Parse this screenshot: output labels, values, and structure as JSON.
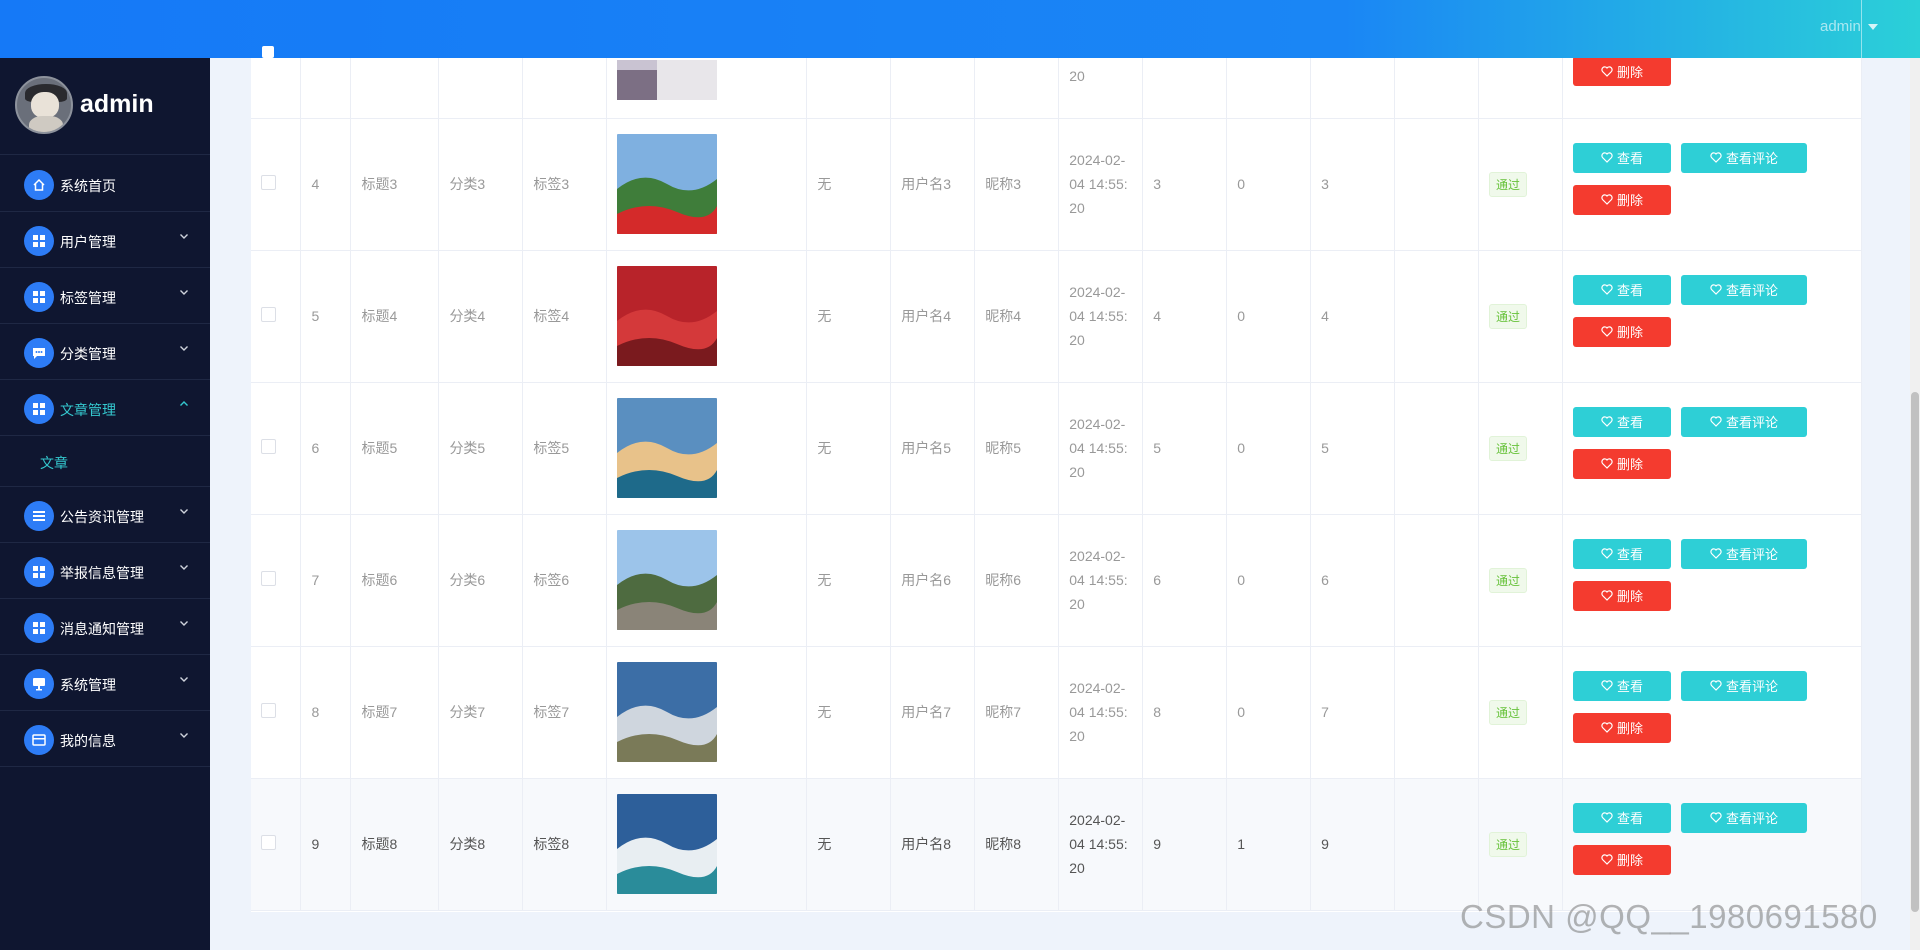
{
  "header": {
    "username": "admin"
  },
  "sidebar": {
    "brand_name": "admin",
    "items": [
      {
        "label": "系统首页",
        "icon": "home-icon"
      },
      {
        "label": "用户管理",
        "icon": "grid-icon"
      },
      {
        "label": "标签管理",
        "icon": "grid-icon"
      },
      {
        "label": "分类管理",
        "icon": "chat-icon"
      },
      {
        "label": "文章管理",
        "icon": "grid-icon",
        "active": true,
        "sub": "文章"
      },
      {
        "label": "公告资讯管理",
        "icon": "list-icon"
      },
      {
        "label": "举报信息管理",
        "icon": "grid-icon"
      },
      {
        "label": "消息通知管理",
        "icon": "grid-icon"
      },
      {
        "label": "系统管理",
        "icon": "monitor-icon"
      },
      {
        "label": "我的信息",
        "icon": "wallet-icon"
      }
    ]
  },
  "table": {
    "top_row": {
      "date_tail": "20",
      "delete_label": "删除"
    },
    "rows": [
      {
        "id": "4",
        "title": "标题3",
        "category": "分类3",
        "tag": "标签3",
        "extra": "无",
        "username": "用户名3",
        "nickname": "昵称3",
        "date1": "2024-02-",
        "date2": "04 14:55:",
        "date3": "20",
        "n1": "3",
        "n2": "0",
        "n3": "3",
        "status": "通过",
        "view": "查看",
        "comments": "查看评论",
        "delete": "删除",
        "img_colors": [
          "#7fb0e0",
          "#3f7d3a",
          "#d42a2a"
        ]
      },
      {
        "id": "5",
        "title": "标题4",
        "category": "分类4",
        "tag": "标签4",
        "extra": "无",
        "username": "用户名4",
        "nickname": "昵称4",
        "date1": "2024-02-",
        "date2": "04 14:55:",
        "date3": "20",
        "n1": "4",
        "n2": "0",
        "n3": "4",
        "status": "通过",
        "view": "查看",
        "comments": "查看评论",
        "delete": "删除",
        "img_colors": [
          "#b8232a",
          "#d4393a",
          "#7a1a1e"
        ]
      },
      {
        "id": "6",
        "title": "标题5",
        "category": "分类5",
        "tag": "标签5",
        "extra": "无",
        "username": "用户名5",
        "nickname": "昵称5",
        "date1": "2024-02-",
        "date2": "04 14:55:",
        "date3": "20",
        "n1": "5",
        "n2": "0",
        "n3": "5",
        "status": "通过",
        "view": "查看",
        "comments": "查看评论",
        "delete": "删除",
        "img_colors": [
          "#5a8fc0",
          "#e8c28a",
          "#1e6a8a"
        ]
      },
      {
        "id": "7",
        "title": "标题6",
        "category": "分类6",
        "tag": "标签6",
        "extra": "无",
        "username": "用户名6",
        "nickname": "昵称6",
        "date1": "2024-02-",
        "date2": "04 14:55:",
        "date3": "20",
        "n1": "6",
        "n2": "0",
        "n3": "6",
        "status": "通过",
        "view": "查看",
        "comments": "查看评论",
        "delete": "删除",
        "img_colors": [
          "#9cc4ea",
          "#4e6b40",
          "#8a8478"
        ]
      },
      {
        "id": "8",
        "title": "标题7",
        "category": "分类7",
        "tag": "标签7",
        "extra": "无",
        "username": "用户名7",
        "nickname": "昵称7",
        "date1": "2024-02-",
        "date2": "04 14:55:",
        "date3": "20",
        "n1": "8",
        "n2": "0",
        "n3": "7",
        "status": "通过",
        "view": "查看",
        "comments": "查看评论",
        "delete": "删除",
        "img_colors": [
          "#3c6ea6",
          "#cfd6de",
          "#7a7a58"
        ]
      },
      {
        "id": "9",
        "title": "标题8",
        "category": "分类8",
        "tag": "标签8",
        "extra": "无",
        "username": "用户名8",
        "nickname": "昵称8",
        "date1": "2024-02-",
        "date2": "04 14:55:",
        "date3": "20",
        "n1": "9",
        "n2": "1",
        "n3": "9",
        "status": "通过",
        "view": "查看",
        "comments": "查看评论",
        "delete": "删除",
        "img_colors": [
          "#2d5f9a",
          "#e8eef2",
          "#2a8c9a"
        ]
      }
    ]
  },
  "watermark": "CSDN @QQ__1980691580"
}
